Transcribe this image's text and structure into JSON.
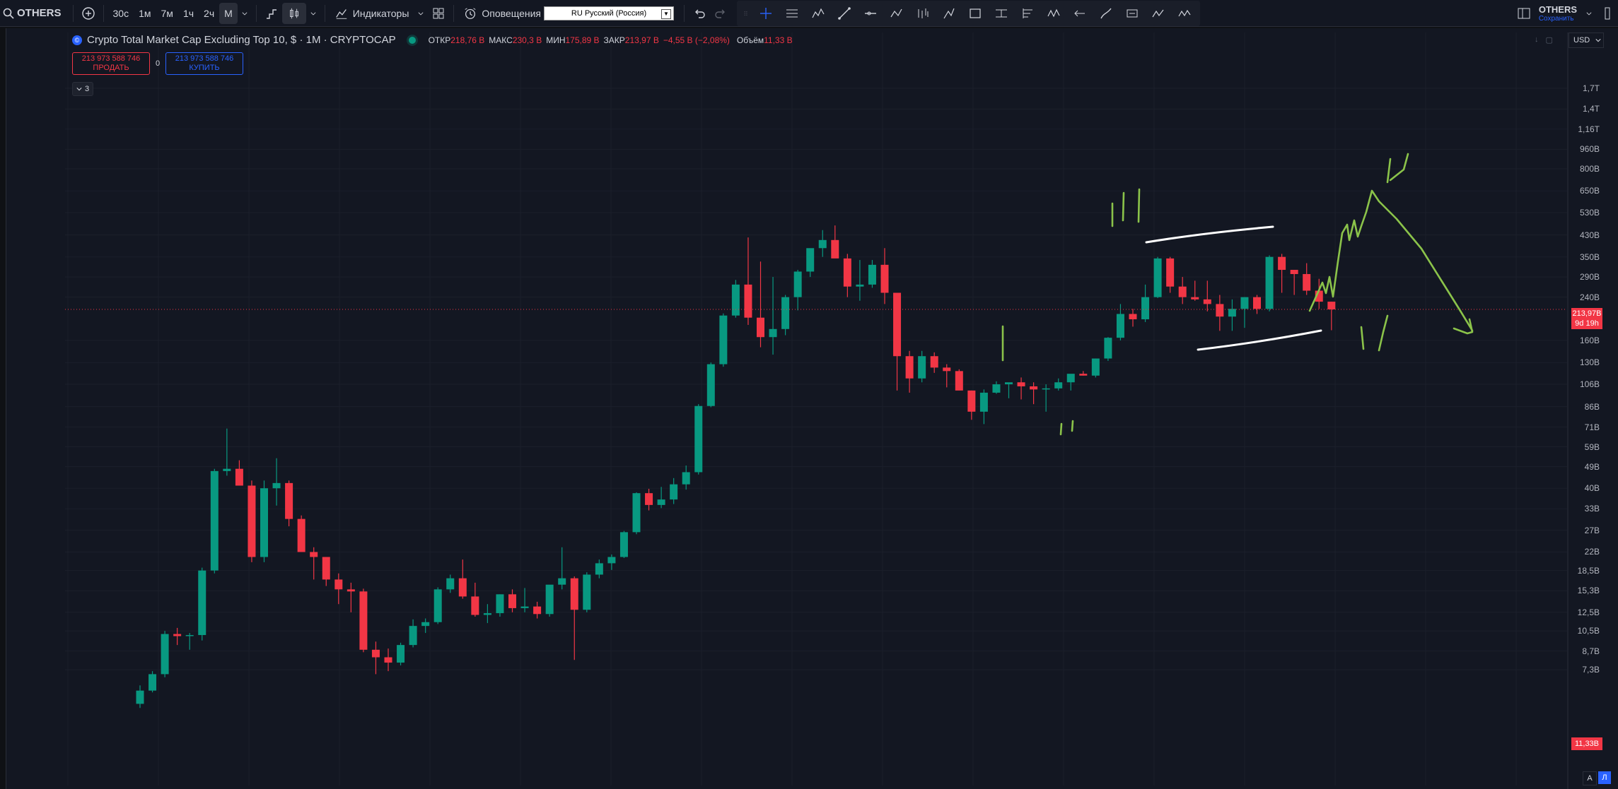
{
  "toolbar": {
    "symbol": "OTHERS",
    "intervals": [
      "30с",
      "1м",
      "7м",
      "1ч",
      "2ч",
      "М"
    ],
    "active_interval": "М",
    "indicators_label": "Индикаторы",
    "alerts_label": "Оповещения",
    "language_select": "RU Русский (Россия)",
    "layout_name": "OTHERS",
    "layout_save": "Сохранить"
  },
  "legend": {
    "title": "Crypto Total Market Cap Excluding Top 10, $ · 1М · CRYPTOCAP",
    "open_label": "ОТКР",
    "open": "218,76 B",
    "high_label": "МАКС",
    "high": "230,3 B",
    "low_label": "МИН",
    "low": "175,89 B",
    "close_label": "ЗАКР",
    "close": "213,97 B",
    "change": "−4,55 B (−2,08%)",
    "volume_label": "Объём",
    "volume": "11,33 B"
  },
  "trade": {
    "sell_price": "213 973 588 746",
    "sell_label": "ПРОДАТЬ",
    "spread": "0",
    "buy_price": "213 973 588 746",
    "buy_label": "КУПИТЬ"
  },
  "collapse": {
    "count": "3"
  },
  "price_scale": {
    "currency": "USD",
    "ticks": [
      "1,7T",
      "1,4T",
      "1,16T",
      "960B",
      "800B",
      "650B",
      "530B",
      "430B",
      "350B",
      "290B",
      "240B",
      "160B",
      "130B",
      "106B",
      "86B",
      "71B",
      "59B",
      "49B",
      "40B",
      "33B",
      "27B",
      "22B",
      "18,5B",
      "15,3B",
      "12,5B",
      "10,5B",
      "8,7B",
      "7,3B"
    ],
    "last_price": "213,97B",
    "countdown": "9d 19h",
    "volume_tag": "11,33B",
    "mode_a": "A",
    "mode_l": "Л"
  },
  "colors": {
    "up": "#089981",
    "down": "#f23645",
    "drawing_green": "#8bc34a",
    "drawing_white": "#ffffff",
    "accent": "#2962ff"
  },
  "chart_data": {
    "type": "candlestick",
    "scale": "log",
    "interval": "1M",
    "unit": "USD, billions",
    "candles": [
      [
        5.3,
        6.3,
        5.1,
        6.0
      ],
      [
        6.0,
        7.2,
        5.9,
        7.0
      ],
      [
        7.0,
        10.5,
        6.8,
        10.2
      ],
      [
        10.2,
        10.8,
        9.2,
        10.0
      ],
      [
        10.0,
        10.3,
        8.8,
        10.1
      ],
      [
        10.1,
        19,
        9.6,
        18.5
      ],
      [
        18.5,
        48,
        18,
        47
      ],
      [
        47,
        70,
        45,
        48
      ],
      [
        48,
        52,
        41,
        41
      ],
      [
        41,
        43,
        20,
        21
      ],
      [
        21,
        43,
        20,
        40
      ],
      [
        40,
        53,
        34,
        42
      ],
      [
        42,
        43,
        28,
        30
      ],
      [
        30,
        31,
        22,
        22
      ],
      [
        22,
        23,
        17,
        21
      ],
      [
        21,
        21,
        16,
        17
      ],
      [
        17,
        18,
        13.5,
        15.5
      ],
      [
        15.5,
        16.5,
        12.5,
        15.2
      ],
      [
        15.2,
        15.6,
        8.6,
        8.8
      ],
      [
        8.8,
        9.5,
        7.0,
        8.2
      ],
      [
        8.2,
        8.9,
        7.2,
        7.8
      ],
      [
        7.8,
        9.4,
        7.6,
        9.2
      ],
      [
        9.2,
        11.7,
        9.0,
        11.0
      ],
      [
        11.0,
        11.8,
        10.3,
        11.4
      ],
      [
        11.4,
        15.8,
        11.2,
        15.5
      ],
      [
        15.5,
        17.8,
        15.0,
        17.2
      ],
      [
        17.2,
        20.5,
        14.2,
        14.5
      ],
      [
        14.5,
        16.5,
        12.0,
        12.2
      ],
      [
        12.2,
        13.5,
        11.3,
        12.4
      ],
      [
        12.4,
        14.8,
        12.0,
        14.8
      ],
      [
        14.8,
        15.5,
        12.5,
        13.0
      ],
      [
        13.0,
        15.7,
        12.5,
        13.2
      ],
      [
        13.2,
        13.8,
        11.8,
        12.3
      ],
      [
        12.3,
        16.0,
        12.0,
        16.2
      ],
      [
        16.2,
        23.0,
        15.5,
        17.2
      ],
      [
        17.2,
        17.5,
        8.0,
        12.8
      ],
      [
        12.8,
        18.2,
        12.5,
        17.8
      ],
      [
        17.8,
        20.5,
        17.2,
        19.8
      ],
      [
        19.8,
        21.5,
        18.6,
        21.0
      ],
      [
        21.0,
        26.8,
        20.8,
        26.5
      ],
      [
        26.5,
        38.5,
        26.0,
        38.2
      ],
      [
        38.2,
        39.8,
        32.5,
        34.2
      ],
      [
        34.2,
        40.5,
        33.2,
        36.0
      ],
      [
        36.0,
        44.0,
        34.5,
        41.5
      ],
      [
        41.5,
        49.5,
        39.5,
        46.5
      ],
      [
        46.5,
        88.0,
        45.5,
        86.5
      ],
      [
        86.5,
        130,
        85.5,
        128
      ],
      [
        128,
        206,
        125,
        202
      ],
      [
        202,
        282,
        198,
        270
      ],
      [
        270,
        420,
        185,
        198
      ],
      [
        198,
        335,
        150,
        165
      ],
      [
        165,
        290,
        140,
        178
      ],
      [
        178,
        245,
        168,
        240
      ],
      [
        240,
        310,
        212,
        305
      ],
      [
        305,
        360,
        290,
        380
      ],
      [
        380,
        450,
        350,
        410
      ],
      [
        410,
        470,
        375,
        345
      ],
      [
        345,
        360,
        240,
        265
      ],
      [
        265,
        340,
        232,
        270
      ],
      [
        270,
        340,
        262,
        325
      ],
      [
        325,
        380,
        225,
        250
      ],
      [
        250,
        250,
        100,
        138
      ],
      [
        138,
        145,
        98,
        112
      ],
      [
        112,
        145,
        108,
        138
      ],
      [
        138,
        143,
        118,
        124
      ],
      [
        124,
        128,
        103,
        120
      ],
      [
        120,
        122,
        103,
        100
      ],
      [
        100,
        100,
        76,
        82
      ],
      [
        82,
        101,
        73,
        98
      ],
      [
        98,
        109,
        97,
        106
      ],
      [
        106,
        106,
        93,
        108
      ],
      [
        108,
        113,
        92,
        104
      ],
      [
        104,
        108,
        88,
        101
      ],
      [
        101,
        106,
        82,
        102
      ],
      [
        102,
        112,
        100,
        108
      ],
      [
        108,
        114,
        100,
        117
      ],
      [
        117,
        120,
        115,
        115
      ],
      [
        115,
        135,
        113,
        135
      ],
      [
        135,
        165,
        132,
        164
      ],
      [
        164,
        225,
        160,
        205
      ],
      [
        205,
        215,
        182,
        195
      ],
      [
        195,
        270,
        190,
        240
      ],
      [
        240,
        350,
        238,
        345
      ],
      [
        345,
        350,
        250,
        265
      ],
      [
        265,
        290,
        225,
        240
      ],
      [
        240,
        280,
        232,
        235
      ],
      [
        235,
        280,
        210,
        225
      ],
      [
        225,
        245,
        175,
        200
      ],
      [
        200,
        235,
        175,
        215
      ],
      [
        215,
        240,
        180,
        240
      ],
      [
        240,
        245,
        205,
        215
      ],
      [
        215,
        355,
        210,
        350
      ],
      [
        350,
        360,
        250,
        310
      ],
      [
        310,
        300,
        245,
        298
      ],
      [
        298,
        330,
        245,
        255
      ],
      [
        255,
        285,
        215,
        230
      ],
      [
        230,
        230,
        176,
        214
      ]
    ]
  }
}
